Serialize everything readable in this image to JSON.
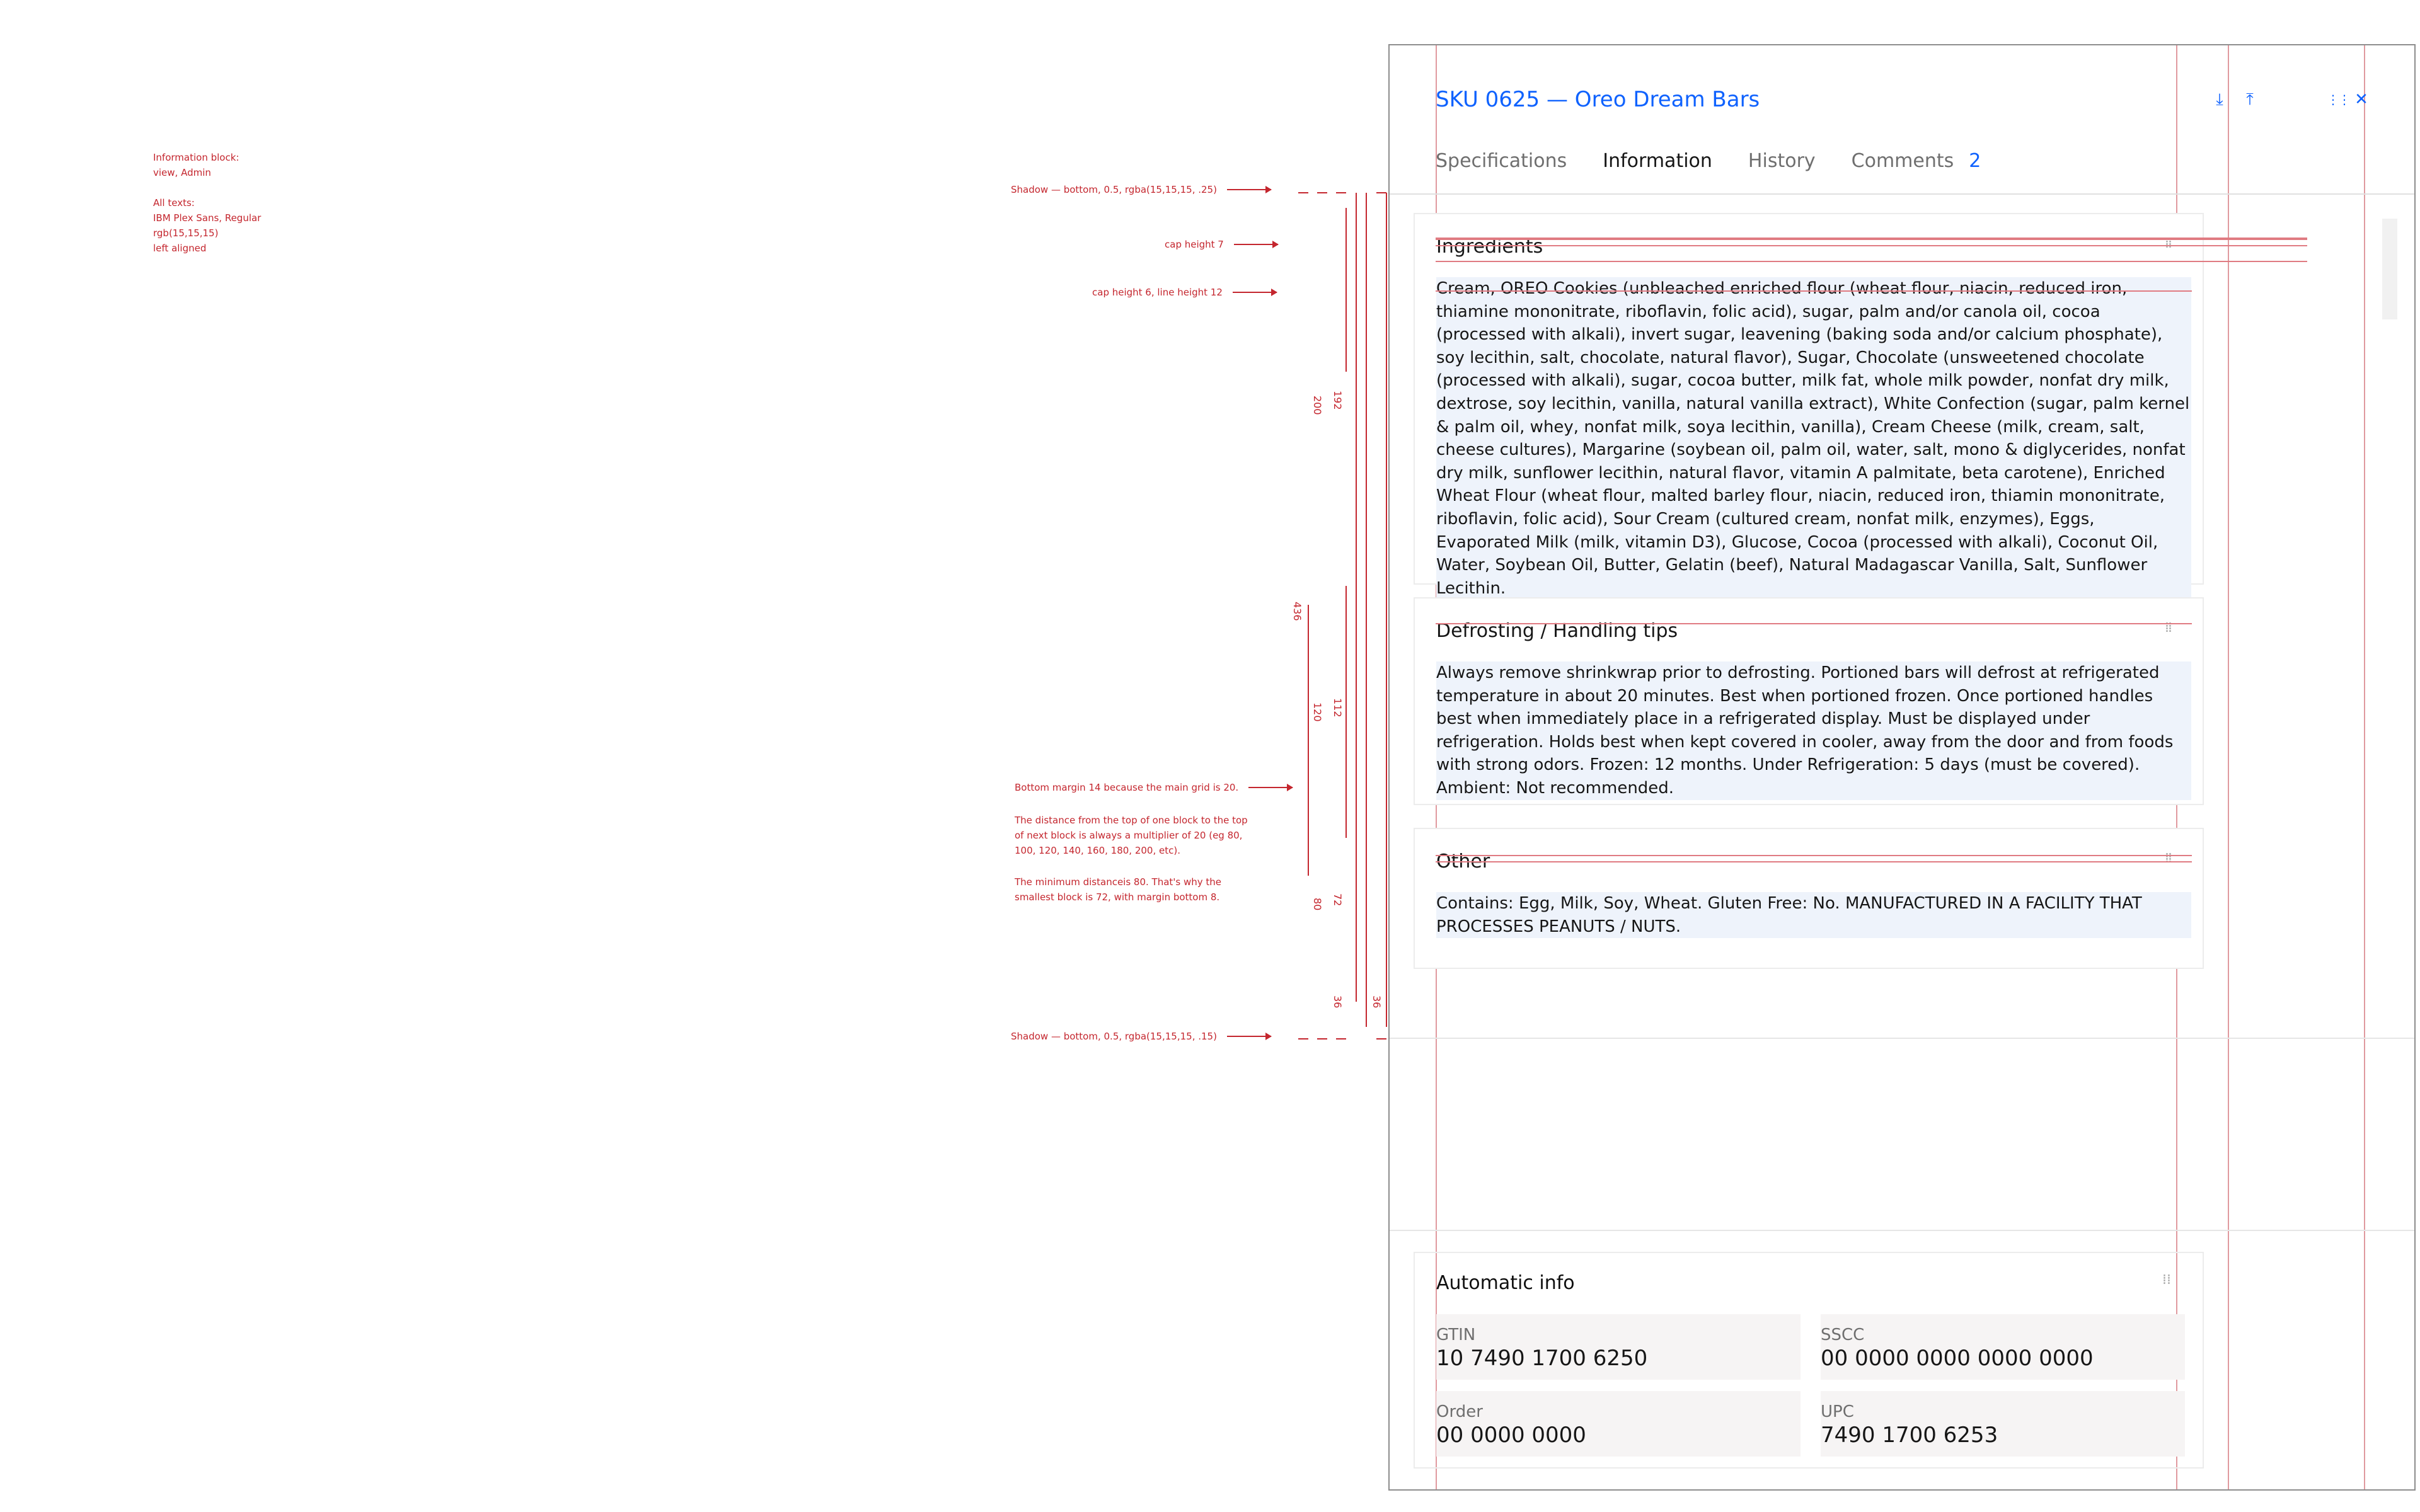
{
  "notes": {
    "info_block": "Information block:\nview, Admin\n\nAll texts:\nIBM Plex Sans, Regular\nrgb(15,15,15)\nleft aligned"
  },
  "annotations": {
    "shadow_top": "Shadow — bottom, 0.5, rgba(15,15,15, .25)",
    "cap7": "cap height 7",
    "cap6": "cap height 6, line height 12",
    "bottom_margin": "Bottom margin 14 because the main grid is 20.",
    "distance": "The distance from the top of one block to the top of next block is always a multiplier of 20 (eg 80, 100, 120, 140, 160, 180, 200, etc).",
    "minimum": "The minimum distanceis 80. That's why the smallest block is 72, with margin bottom 8.",
    "shadow_bottom": "Shadow — bottom, 0.5, rgba(15,15,15, .15)"
  },
  "spacing_labels": {
    "v200": "200",
    "v192": "192",
    "v436": "436",
    "v120": "120",
    "v112": "112",
    "v80": "80",
    "v72": "72",
    "v36a": "36",
    "v36b": "36"
  },
  "panel": {
    "title": "SKU 0625 — Oreo Dream Bars",
    "icons": [
      "download-icon",
      "upload-icon",
      "drag-handle-icon",
      "close-icon"
    ],
    "tabs": [
      {
        "label": "Specifications"
      },
      {
        "label": "Information"
      },
      {
        "label": "History"
      },
      {
        "label": "Comments",
        "count": "2"
      }
    ],
    "blocks": {
      "ingredients": {
        "title": "Ingredients",
        "text": "Cream, OREO Cookies (unbleached enriched flour (wheat flour, niacin, reduced iron, thiamine mononitrate, riboflavin, folic acid), sugar, palm and/or canola oil, cocoa (processed with alkali), invert sugar, leavening (baking soda and/or calcium phosphate), soy lecithin, salt, chocolate, natural flavor), Sugar, Chocolate (unsweetened chocolate (processed with alkali), sugar, cocoa butter, milk fat, whole milk powder, nonfat dry milk, dextrose, soy lecithin, vanilla, natural vanilla extract), White Confection (sugar, palm kernel & palm oil, whey, nonfat milk, soya lecithin, vanilla), Cream Cheese (milk, cream, salt, cheese cultures), Margarine (soybean oil, palm oil, water, salt, mono & diglycerides, nonfat dry milk, sunflower lecithin, natural flavor, vitamin A palmitate, beta carotene), Enriched Wheat Flour (wheat flour, malted barley flour, niacin, reduced iron, thiamin mononitrate, riboflavin, folic acid), Sour Cream (cultured cream, nonfat milk, enzymes), Eggs, Evaporated Milk (milk, vitamin D3), Glucose, Cocoa (processed with alkali), Coconut Oil, Water, Soybean Oil, Butter, Gelatin (beef), Natural Madagascar Vanilla, Salt, Sunflower Lecithin."
      },
      "defrost": {
        "title": "Defrosting / Handling tips",
        "text": "Always remove shrinkwrap prior to defrosting. Portioned bars will defrost at refrigerated temperature in about 20 minutes. Best when portioned frozen. Once portioned handles best when immediately place in a refrigerated display. Must be displayed under refrigeration. Holds best when kept covered in cooler, away from the door and from foods with strong odors. Frozen: 12 months. Under Refrigeration: 5 days (must be covered). Ambient: Not recommended."
      },
      "other": {
        "title": "Other",
        "text": "Contains: Egg, Milk, Soy, Wheat. Gluten Free: No. MANUFACTURED IN A FACILITY THAT PROCESSES PEANUTS / NUTS."
      }
    },
    "auto_info": {
      "title": "Automatic info",
      "fields": [
        {
          "label": "GTIN",
          "value": "10 7490 1700 6250"
        },
        {
          "label": "SSCC",
          "value": "00 0000 0000 0000 0000"
        },
        {
          "label": "Order",
          "value": "00 0000 0000"
        },
        {
          "label": "UPC",
          "value": "7490 1700 6253"
        }
      ]
    }
  }
}
